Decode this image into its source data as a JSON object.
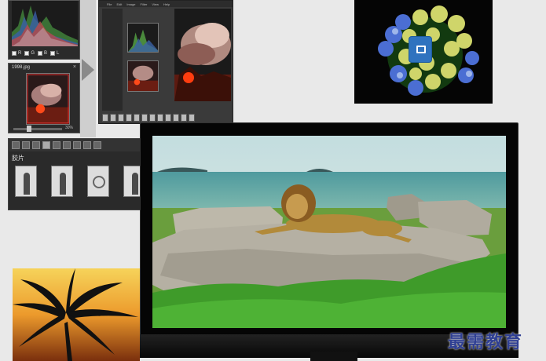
{
  "histogram_panel": {
    "channels": [
      "R",
      "G",
      "B",
      "L"
    ]
  },
  "navigator_panel": {
    "title": "1998.jpg",
    "close_glyph": "×",
    "zoom_label": "30%",
    "zoom_level": 0.3
  },
  "editor_window": {
    "menu_items": [
      "File",
      "Edit",
      "Image",
      "Filter",
      "View",
      "Help"
    ]
  },
  "browser_panel": {
    "label": "胶片",
    "thumbnails": [
      "girl-photo",
      "girl-photo",
      "necklace-photo",
      "girl-photo"
    ]
  },
  "overlay_icon": {
    "name": "photo-app-icon"
  },
  "watermark": {
    "text": "最需教育"
  },
  "colors": {
    "background": "#e9e9e9",
    "panel": "#2b2b2b",
    "tv_frame": "#050505",
    "watermark": "#2f3f93",
    "app_icon": "#2f73bf"
  }
}
